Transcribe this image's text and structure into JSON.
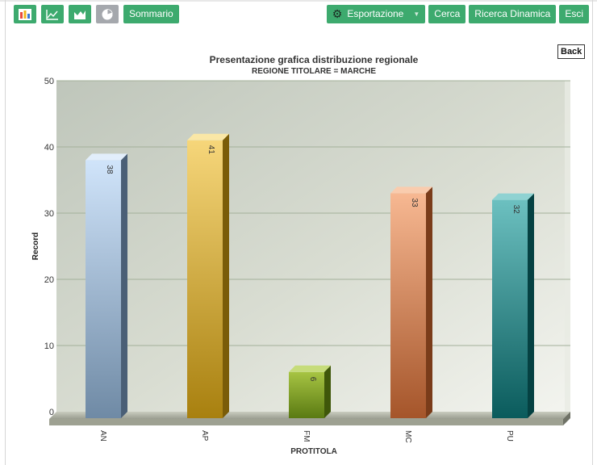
{
  "toolbar": {
    "chart_type_icons": [
      "bar-chart-icon",
      "line-chart-icon",
      "area-chart-icon",
      "pie-chart-icon"
    ],
    "summary_label": "Sommario",
    "export_label": "Esportazione",
    "search_label": "Cerca",
    "dynamic_search_label": "Ricerca Dinamica",
    "exit_label": "Esci",
    "back_label": "Back"
  },
  "colors": {
    "button_green": "#3daa6e",
    "button_grey": "#a5a8ad"
  },
  "chart_data": {
    "type": "bar",
    "title": "Presentazione grafica distribuzione regionale",
    "subtitle": "REGIONE TITOLARE = MARCHE",
    "xlabel": "PROTITOLA",
    "ylabel": "Record",
    "ylim": [
      0,
      50
    ],
    "yticks": [
      0,
      10,
      20,
      30,
      40,
      50
    ],
    "grid": true,
    "categories": [
      "AN",
      "AP",
      "FM",
      "MC",
      "PU"
    ],
    "values": [
      38,
      41,
      6,
      33,
      32
    ],
    "bar_colors": [
      {
        "top": "#d0e4fa",
        "bottom": "#6f8aa5",
        "side": "#4a5f76",
        "cap": "#e2eefb"
      },
      {
        "top": "#f6d67a",
        "bottom": "#a8800f",
        "side": "#7a5c08",
        "cap": "#fae7a6"
      },
      {
        "top": "#a7c443",
        "bottom": "#5a7a12",
        "side": "#3f570a",
        "cap": "#c6dc7a"
      },
      {
        "top": "#f7b892",
        "bottom": "#a5552a",
        "side": "#7a3c1a",
        "cap": "#f9ccae"
      },
      {
        "top": "#6cc0c0",
        "bottom": "#0a5b5c",
        "side": "#054142",
        "cap": "#8fd2d2"
      }
    ]
  }
}
